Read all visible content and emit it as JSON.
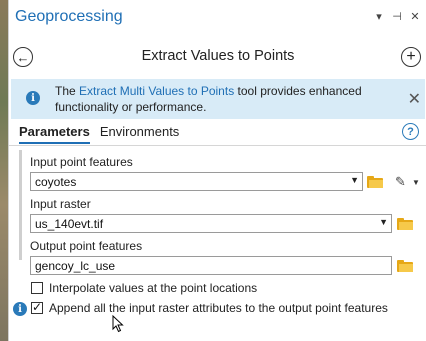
{
  "panel": {
    "title": "Geoprocessing",
    "titlebar_icons": [
      "menu-down-icon",
      "pin-icon",
      "close-icon"
    ]
  },
  "tool": {
    "title": "Extract Values to Points",
    "back_icon": "back-arrow-icon",
    "add_icon": "plus-icon"
  },
  "banner": {
    "prefix": "The ",
    "link": "Extract Multi Values to Points",
    "suffix": " tool provides enhanced",
    "line2": "functionality or performance.",
    "close_icon": "close-icon"
  },
  "tabs": [
    {
      "label": "Parameters",
      "active": true
    },
    {
      "label": "Environments",
      "active": false
    }
  ],
  "params": {
    "input_point_features": {
      "label": "Input point features",
      "value": "coyotes"
    },
    "input_raster": {
      "label": "Input raster",
      "value": "us_140evt.tif"
    },
    "output_point_features": {
      "label": "Output point features",
      "value": "gencoy_lc_use"
    },
    "interpolate": {
      "label": "Interpolate values at the point locations",
      "checked": false
    },
    "append": {
      "label": "Append all the input raster attributes to the output point features",
      "checked": true
    }
  },
  "colors": {
    "accent": "#1f6fb5",
    "banner_bg": "#d8ebf7",
    "folder": "#e6a817"
  }
}
